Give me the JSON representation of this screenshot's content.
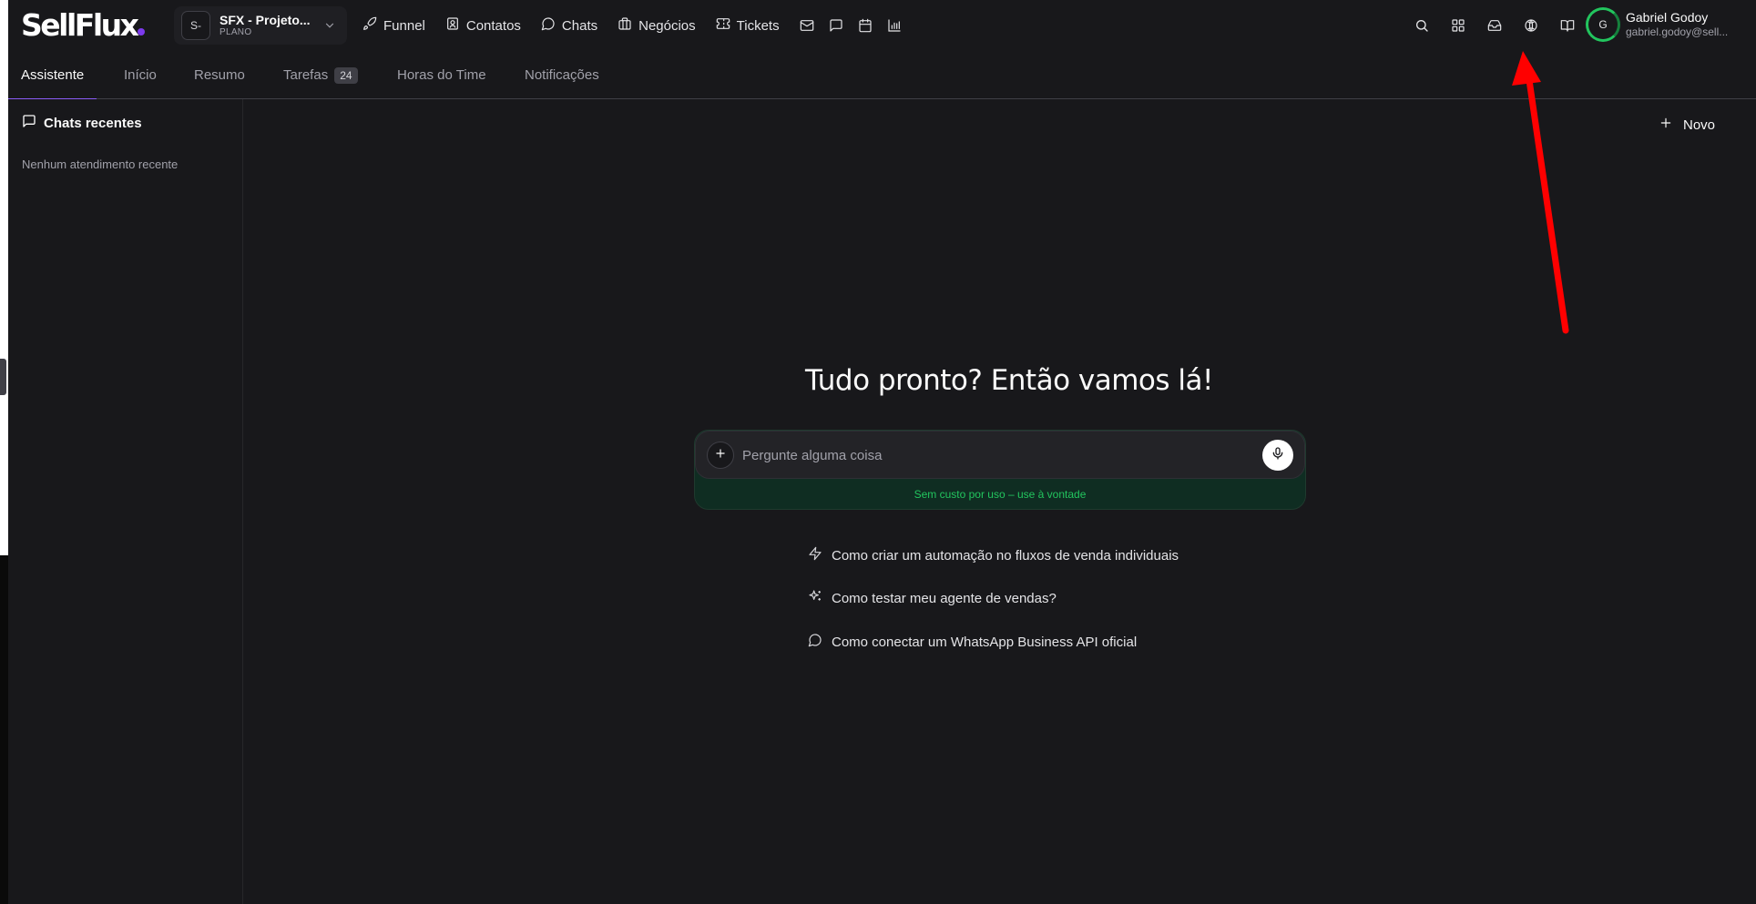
{
  "brand": {
    "logo_text": "SellFlux",
    "accent": "#7c3aed"
  },
  "workspace": {
    "avatar": "S-",
    "name": "SFX - Projeto...",
    "plan": "PLANO"
  },
  "nav": {
    "items": [
      {
        "label": "Funnel",
        "icon": "rocket-icon"
      },
      {
        "label": "Contatos",
        "icon": "contact-card-icon"
      },
      {
        "label": "Chats",
        "icon": "chat-bubble-icon"
      },
      {
        "label": "Negócios",
        "icon": "briefcase-icon"
      },
      {
        "label": "Tickets",
        "icon": "ticket-icon"
      }
    ],
    "icon_only": [
      "mail-icon",
      "message-square-icon",
      "calendar-icon",
      "bar-chart-icon"
    ]
  },
  "right_icons": [
    "search-icon",
    "grid-icon",
    "inbox-icon",
    "globe-icon",
    "book-icon"
  ],
  "user": {
    "initial": "G",
    "name": "Gabriel Godoy",
    "email": "gabriel.godoy@sell..."
  },
  "tabs": [
    {
      "label": "Assistente",
      "active": true
    },
    {
      "label": "Início"
    },
    {
      "label": "Resumo"
    },
    {
      "label": "Tarefas",
      "badge": "24"
    },
    {
      "label": "Horas do Time"
    },
    {
      "label": "Notificações"
    }
  ],
  "sidebar": {
    "title": "Chats recentes",
    "empty": "Nenhum atendimento recente"
  },
  "main": {
    "new_label": "Novo",
    "headline": "Tudo pronto? Então vamos lá!",
    "input_placeholder": "Pergunte alguma coisa",
    "note": "Sem custo por uso – use à vontade",
    "suggestions": [
      {
        "label": "Como criar um automação no fluxos de venda individuais",
        "icon": "zap-icon"
      },
      {
        "label": "Como testar meu agente de vendas?",
        "icon": "sparkles-icon"
      },
      {
        "label": "Como conectar um WhatsApp Business API oficial",
        "icon": "chat-bubble-icon"
      }
    ]
  },
  "colors": {
    "background": "#18181b",
    "active_tab": "#8b5cf6",
    "note_green": "#22c55e",
    "annotation_arrow": "#ff0000"
  }
}
